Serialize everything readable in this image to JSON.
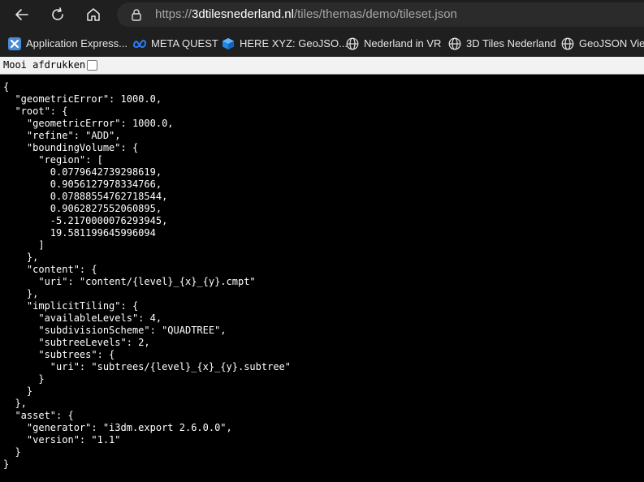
{
  "toolbar": {
    "back_icon": "arrow-left-icon",
    "reload_icon": "reload-icon",
    "home_icon": "home-icon"
  },
  "address": {
    "scheme": "https://",
    "host": "3dtilesnederland.nl",
    "path": "/tiles/themas/demo/tileset.json"
  },
  "favorites": [
    {
      "label": "Application Express...",
      "icon": "apex-icon"
    },
    {
      "label": "META QUEST",
      "icon": "meta-icon"
    },
    {
      "label": "HERE XYZ: GeoJSO...",
      "icon": "cube-icon"
    },
    {
      "label": "Nederland in VR",
      "icon": "globe-icon"
    },
    {
      "label": "3D Tiles Nederland",
      "icon": "globe-icon"
    },
    {
      "label": "GeoJSON Viewe",
      "icon": "globe-icon"
    }
  ],
  "pretty_print": {
    "label": "Mooi afdrukken",
    "checked": false
  },
  "json_text": "{\n  \"geometricError\": 1000.0,\n  \"root\": {\n    \"geometricError\": 1000.0,\n    \"refine\": \"ADD\",\n    \"boundingVolume\": {\n      \"region\": [\n        0.0779642739298619,\n        0.9056127978334766,\n        0.07888554762718544,\n        0.9062827552060895,\n        -5.2170000076293945,\n        19.581199645996094\n      ]\n    },\n    \"content\": {\n      \"uri\": \"content/{level}_{x}_{y}.cmpt\"\n    },\n    \"implicitTiling\": {\n      \"availableLevels\": 4,\n      \"subdivisionScheme\": \"QUADTREE\",\n      \"subtreeLevels\": 2,\n      \"subtrees\": {\n        \"uri\": \"subtrees/{level}_{x}_{y}.subtree\"\n      }\n    }\n  },\n  \"asset\": {\n    \"generator\": \"i3dm.export 2.6.0.0\",\n    \"version\": \"1.1\"\n  }\n}"
}
